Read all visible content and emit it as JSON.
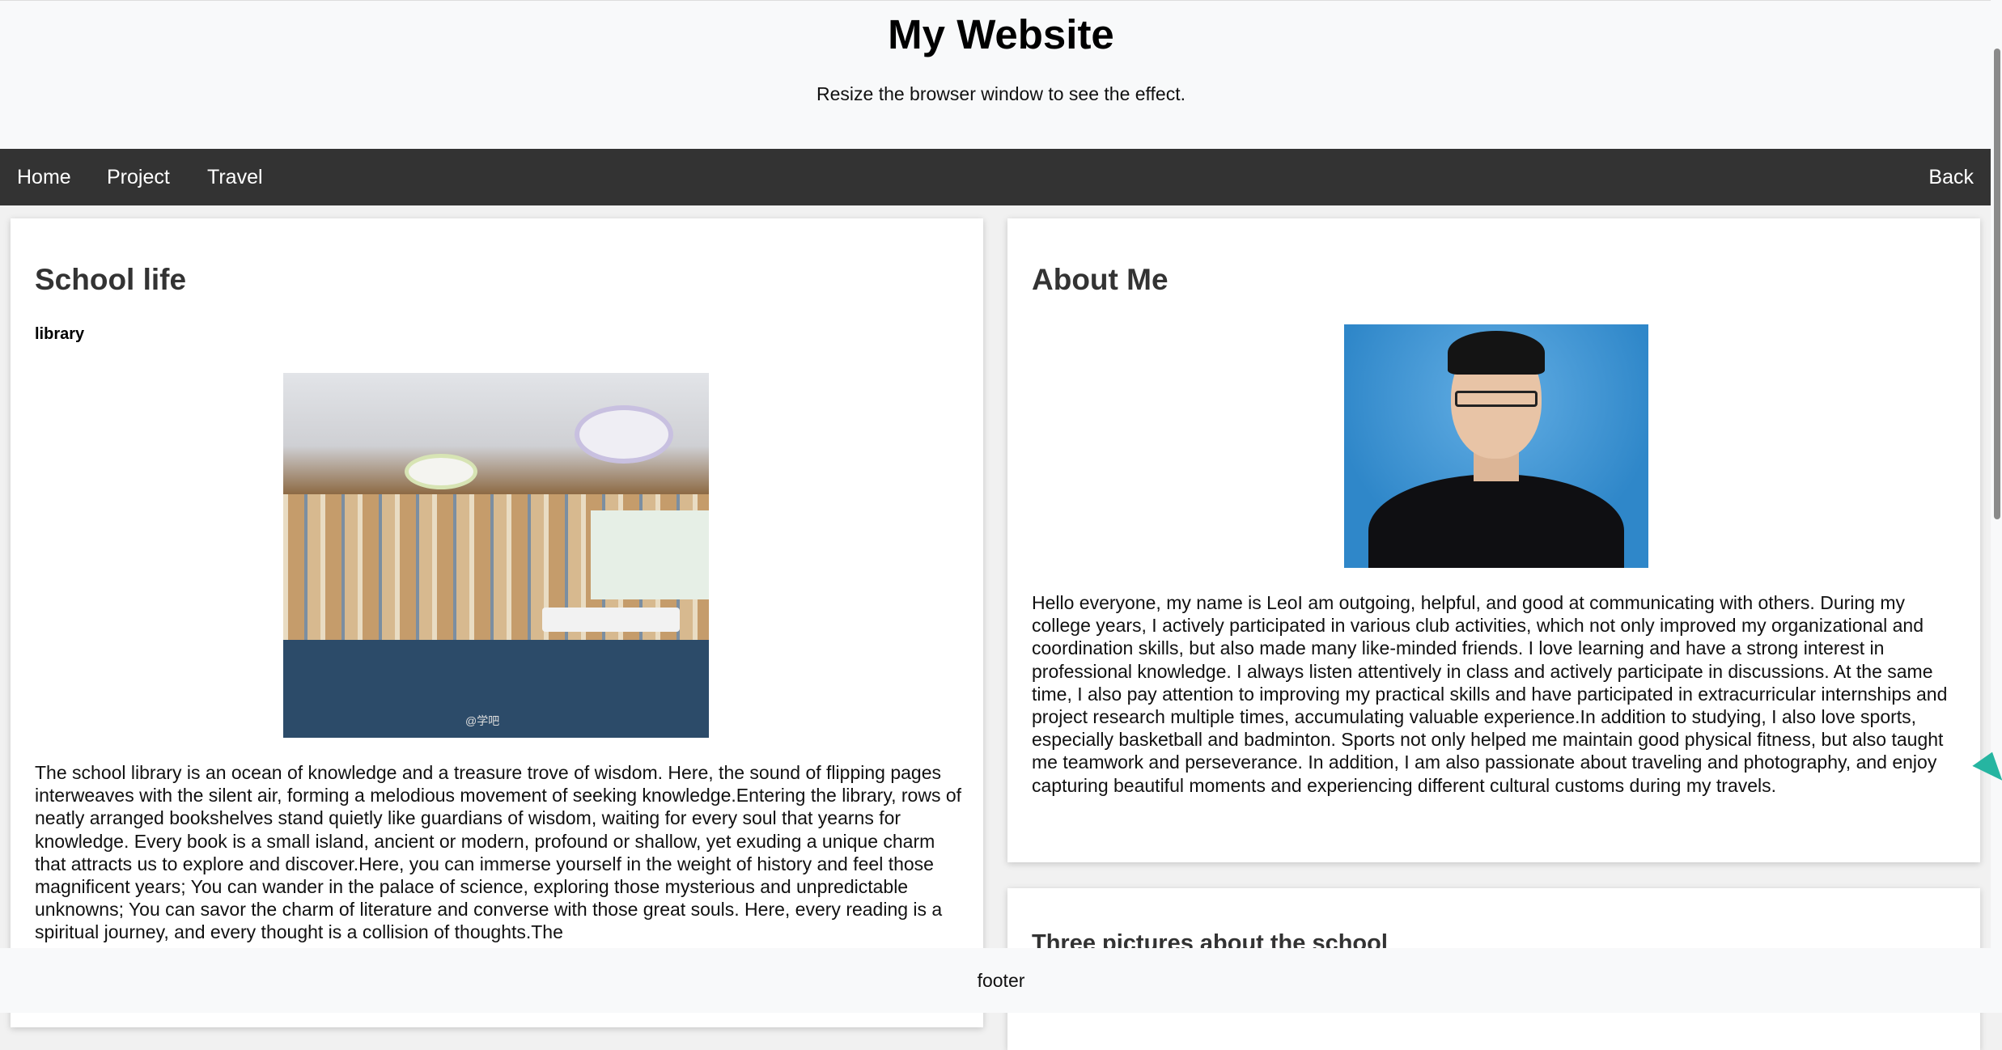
{
  "header": {
    "title": "My Website",
    "subtitle": "Resize the browser window to see the effect."
  },
  "nav": {
    "home": "Home",
    "project": "Project",
    "travel": "Travel",
    "back": "Back"
  },
  "school_life": {
    "title": "School life",
    "subhead": "library",
    "watermark": "@学吧",
    "paragraph": "The school library is an ocean of knowledge and a treasure trove of wisdom. Here, the sound of flipping pages interweaves with the silent air, forming a melodious movement of seeking knowledge.Entering the library, rows of neatly arranged bookshelves stand quietly like guardians of wisdom, waiting for every soul that yearns for knowledge. Every book is a small island, ancient or modern, profound or shallow, yet exuding a unique charm that attracts us to explore and discover.Here, you can immerse yourself in the weight of history and feel those magnificent years; You can wander in the palace of science, exploring those mysterious and unpredictable unknowns; You can savor the charm of literature and converse with those great souls. Here, every reading is a spiritual journey, and every thought is a collision of thoughts.The"
  },
  "about": {
    "title": "About Me",
    "paragraph": "Hello everyone, my name is LeoI am outgoing, helpful, and good at communicating with others. During my college years, I actively participated in various club activities, which not only improved my organizational and coordination skills, but also made many like-minded friends. I love learning and have a strong interest in professional knowledge. I always listen attentively in class and actively participate in discussions. At the same time, I also pay attention to improving my practical skills and have participated in extracurricular internships and project research multiple times, accumulating valuable experience.In addition to studying, I also love sports, especially basketball and badminton. Sports not only helped me maintain good physical fitness, but also taught me teamwork and perseverance. In addition, I am also passionate about traveling and photography, and enjoy capturing beautiful moments and experiencing different cultural customs during my travels."
  },
  "pictures": {
    "title": "Three pictures about the school"
  },
  "footer": {
    "text": "footer"
  },
  "colors": {
    "navbar": "#333333",
    "header_bg": "#f8f9fa",
    "card_bg": "#ffffff"
  }
}
